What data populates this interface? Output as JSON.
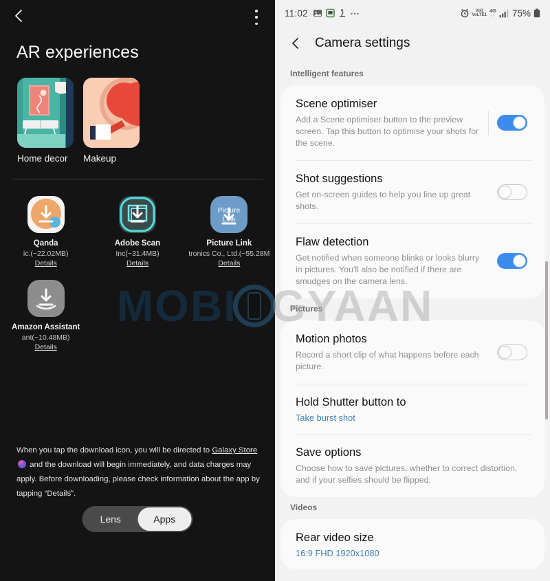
{
  "left": {
    "nav": {
      "back_icon": "back-chevron-icon",
      "more_icon": "kebab-menu-icon"
    },
    "title": "AR experiences",
    "ar_items": [
      {
        "label": "Home decor",
        "icon": "home-decor-thumbnail"
      },
      {
        "label": "Makeup",
        "icon": "makeup-thumbnail"
      }
    ],
    "apps": [
      {
        "name": "Qanda",
        "developer": "ic.(~22.02MB)",
        "details": "Details",
        "icon": "qanda-app-icon"
      },
      {
        "name": "Adobe Scan",
        "developer": "Inc(~31.4MB)",
        "details": "Details",
        "icon": "adobe-scan-app-icon"
      },
      {
        "name": "Picture Link",
        "developer": "tronics Co., Ltd.(~55.28M",
        "details": "Details",
        "icon": "picture-link-app-icon"
      },
      {
        "name": "Amazon Assistant",
        "developer": "ant(~10.48MB)",
        "details": "Details",
        "icon": "amazon-assistant-app-icon"
      }
    ],
    "footer": {
      "part1": "When you tap the download icon, you will be directed to ",
      "link1": "Galaxy Store",
      "store_icon": "galaxy-store-icon",
      "part2": " and the download will begin immediately, and data charges may apply. Before downloading, please check information about the app by tapping “Details”."
    },
    "segmented": {
      "options": [
        "Lens",
        "Apps"
      ],
      "selected": "Apps"
    }
  },
  "right": {
    "status_bar": {
      "time": "11:02",
      "icons": [
        "photo-icon",
        "green-app-icon",
        "mute-icon",
        "more-notifications-icon"
      ],
      "alarm_icon": "alarm-icon",
      "volte": "VoLTE1",
      "network": "4G",
      "signal_icon": "signal-bars-icon",
      "battery_percent": "75%",
      "battery_icon": "battery-icon"
    },
    "header": {
      "back_icon": "back-chevron-icon",
      "title": "Camera settings"
    },
    "sections": [
      {
        "label": "Intelligent features",
        "items": [
          {
            "title": "Scene optimiser",
            "desc": "Add a Scene optimiser button to the preview screen. Tap this button to optimise your shots for the scene.",
            "control": "toggle",
            "state": "on"
          },
          {
            "title": "Shot suggestions",
            "desc": "Get on-screen guides to help you line up great shots.",
            "control": "toggle",
            "state": "off"
          },
          {
            "title": "Flaw detection",
            "desc": "Get notified when someone blinks or looks blurry in pictures. You'll also be notified if there are smudges on the camera lens.",
            "control": "toggle",
            "state": "on"
          }
        ]
      },
      {
        "label": "Pictures",
        "items": [
          {
            "title": "Motion photos",
            "desc": "Record a short clip of what happens before each picture.",
            "control": "toggle",
            "state": "off"
          },
          {
            "title": "Hold Shutter button to",
            "value": "Take burst shot",
            "control": "none"
          },
          {
            "title": "Save options",
            "desc": "Choose how to save pictures, whether to correct distortion, and if your selfies should be flipped.",
            "control": "none"
          }
        ]
      },
      {
        "label": "Videos",
        "items": [
          {
            "title": "Rear video size",
            "value": "16:9 FHD 1920x1080",
            "control": "none"
          }
        ]
      }
    ]
  },
  "watermark": {
    "part_a": "MOBI",
    "part_b": "GYAAN"
  },
  "colors": {
    "accent_toggle": "#3d8ced",
    "link_value": "#3f7fb5",
    "dark_bg": "#141414",
    "light_bg": "#f2f2f2"
  }
}
